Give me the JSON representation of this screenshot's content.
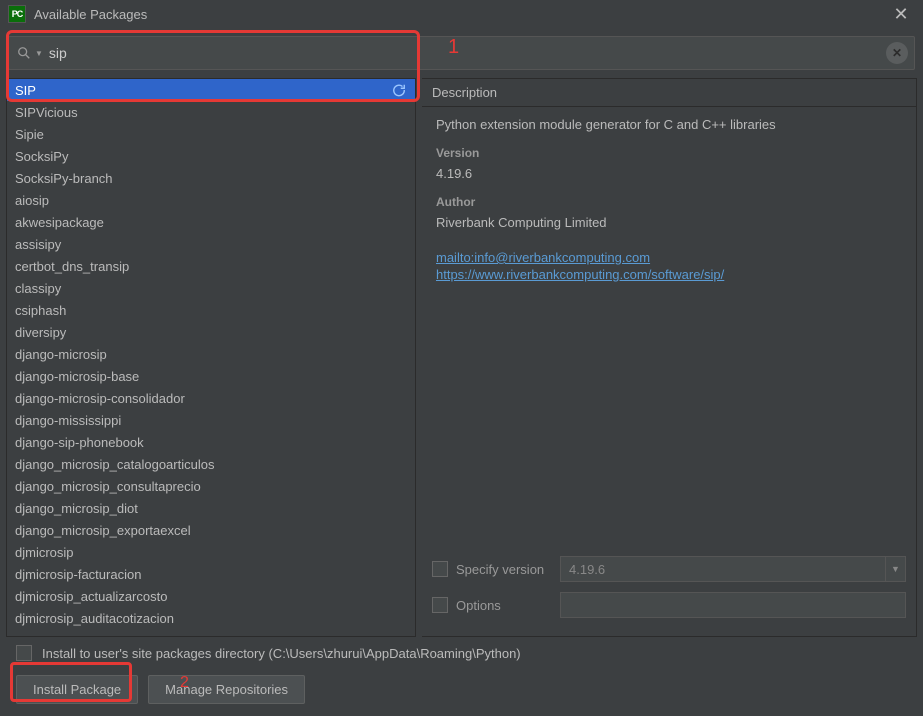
{
  "title": "Available Packages",
  "search": {
    "value": "sip"
  },
  "packages": [
    "SIP",
    "SIPVicious",
    "Sipie",
    "SocksiPy",
    "SocksiPy-branch",
    "aiosip",
    "akwesipackage",
    "assisipy",
    "certbot_dns_transip",
    "classipy",
    "csiphash",
    "diversipy",
    "django-microsip",
    "django-microsip-base",
    "django-microsip-consolidador",
    "django-mississippi",
    "django-sip-phonebook",
    "django_microsip_catalogoarticulos",
    "django_microsip_consultaprecio",
    "django_microsip_diot",
    "django_microsip_exportaexcel",
    "djmicrosip",
    "djmicrosip-facturacion",
    "djmicrosip_actualizarcosto",
    "djmicrosip_auditacotizacion"
  ],
  "selected_index": 0,
  "detail": {
    "header": "Description",
    "description": "Python extension module generator for C and C++ libraries",
    "version_label": "Version",
    "version": "4.19.6",
    "author_label": "Author",
    "author": "Riverbank Computing Limited",
    "link1": "mailto:info@riverbankcomputing.com",
    "link2": "https://www.riverbankcomputing.com/software/sip/"
  },
  "specify": {
    "label": "Specify version",
    "value": "4.19.6"
  },
  "options": {
    "label": "Options",
    "value": ""
  },
  "install_to_user": "Install to user's site packages directory (C:\\Users\\zhurui\\AppData\\Roaming\\Python)",
  "buttons": {
    "install": "Install Package",
    "manage": "Manage Repositories"
  },
  "annotations": {
    "one": "1",
    "two": "2"
  }
}
